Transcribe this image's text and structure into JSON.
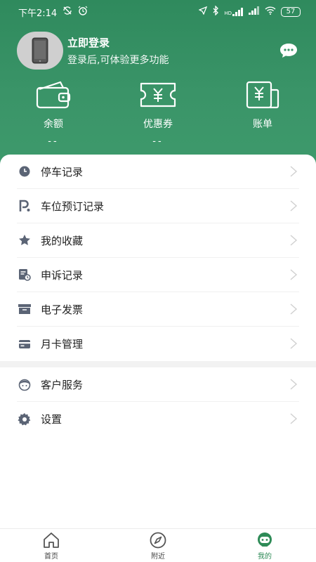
{
  "status_bar": {
    "time": "下午2:14",
    "battery": "57",
    "hd_label": "HD"
  },
  "profile": {
    "login_title": "立即登录",
    "login_subtitle": "登录后,可体验更多功能"
  },
  "stats": [
    {
      "label": "余额",
      "value": "--"
    },
    {
      "label": "优惠券",
      "value": "--"
    },
    {
      "label": "账单",
      "value": ""
    }
  ],
  "menu_group_1": [
    {
      "label": "停车记录",
      "icon": "clock-icon"
    },
    {
      "label": "车位预订记录",
      "icon": "parking-icon"
    },
    {
      "label": "我的收藏",
      "icon": "star-icon"
    },
    {
      "label": "申诉记录",
      "icon": "appeal-icon"
    },
    {
      "label": "电子发票",
      "icon": "invoice-icon"
    },
    {
      "label": "月卡管理",
      "icon": "card-icon"
    }
  ],
  "menu_group_2": [
    {
      "label": "客户服务",
      "icon": "customer-service-icon"
    },
    {
      "label": "设置",
      "icon": "gear-icon"
    }
  ],
  "tabs": [
    {
      "label": "首页",
      "icon": "home-icon",
      "active": false
    },
    {
      "label": "附近",
      "icon": "compass-icon",
      "active": false
    },
    {
      "label": "我的",
      "icon": "robot-icon",
      "active": true
    }
  ],
  "colors": {
    "brand_green": "#3a9468",
    "active_tab": "#2e8b57",
    "icon_gray": "#5b6475"
  }
}
